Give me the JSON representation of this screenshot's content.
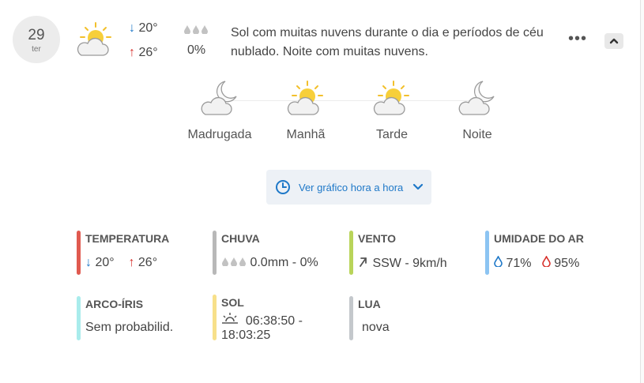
{
  "colors": {
    "arrow_down": "#1e78c8",
    "arrow_up": "#d8312c",
    "accent_blue": "#1e78c8",
    "bar_temperature": "#e05a50",
    "bar_rain": "#b8b8b8",
    "bar_wind": "#b9d45a",
    "bar_humidity": "#8cc4f2",
    "bar_rainbow": "#a9ecec",
    "bar_sun": "#f7e08a",
    "bar_moon": "#c4c8cc"
  },
  "day": {
    "number": "29",
    "weekday": "ter"
  },
  "summary": {
    "icon": "partly-cloudy-sun-icon",
    "temp_min": "20°",
    "temp_max": "26°",
    "rain_icon": "rain-drops-icon",
    "rain_probability": "0%",
    "description": "Sol com muitas nuvens durante o dia e períodos de céu nublado. Noite com muitas nuvens."
  },
  "periods": [
    {
      "label": "Madrugada",
      "icon": "cloudy-night-icon"
    },
    {
      "label": "Manhã",
      "icon": "partly-cloudy-sun-icon"
    },
    {
      "label": "Tarde",
      "icon": "partly-cloudy-sun-icon"
    },
    {
      "label": "Noite",
      "icon": "cloudy-night-icon"
    }
  ],
  "hourly_button": {
    "label": "Ver gráfico hora a hora",
    "icon": "clock-icon",
    "chevron": "chevron-down-icon"
  },
  "stats": {
    "temperature": {
      "title": "TEMPERATURA",
      "min": "20°",
      "max": "26°"
    },
    "rain": {
      "title": "CHUVA",
      "value": "0.0mm - 0%"
    },
    "wind": {
      "title": "VENTO",
      "value": "SSW - 9km/h",
      "icon": "wind-direction-arrow-icon"
    },
    "humidity": {
      "title": "UMIDADE DO AR",
      "min": "71%",
      "max": "95%"
    },
    "rainbow": {
      "title": "ARCO-ÍRIS",
      "value": "Sem probabilid."
    },
    "sun": {
      "title": "SOL",
      "line1": "06:38:50 -",
      "line2": "18:03:25",
      "icon": "sunrise-icon"
    },
    "moon": {
      "title": "LUA",
      "value": "nova"
    }
  }
}
